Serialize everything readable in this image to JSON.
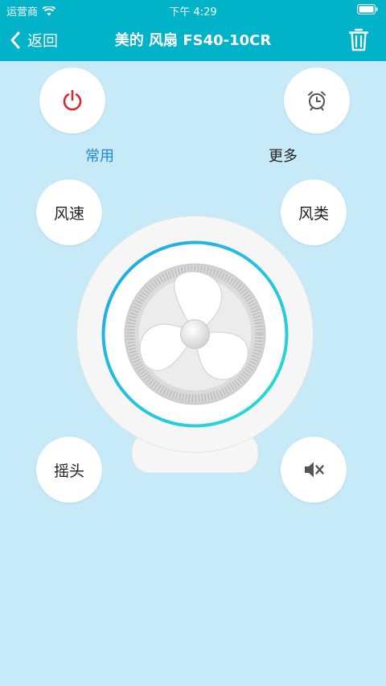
{
  "status_bar": {
    "carrier": "运营商",
    "time": "下午 4:29"
  },
  "nav": {
    "back_label": "返回",
    "title": "美的 风扇 FS40-10CR"
  },
  "tabs": {
    "common": "常用",
    "more": "更多"
  },
  "controls": {
    "speed": "风速",
    "type": "风类",
    "swing": "摇头"
  },
  "colors": {
    "header": "#01b3c9",
    "background": "#c6eaf8",
    "power_red": "#d9272e",
    "active_tab": "#1f87d9"
  },
  "icons": [
    "wifi-icon",
    "battery-icon",
    "back-chevron-icon",
    "trash-icon",
    "power-icon",
    "alarm-clock-icon",
    "fan-icon",
    "mute-icon"
  ]
}
